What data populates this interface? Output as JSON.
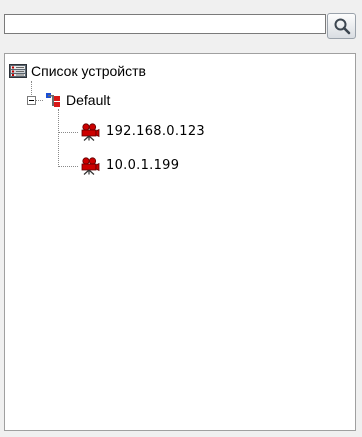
{
  "search": {
    "value": "",
    "placeholder": ""
  },
  "tree": {
    "root": {
      "label": "Список устройств",
      "icon": "device-list-icon"
    },
    "group": {
      "label": "Default",
      "icon": "network-group-icon",
      "expanded": true
    },
    "devices": [
      {
        "label": "192.168.0.123",
        "icon": "camera-icon"
      },
      {
        "label": "10.0.1.199",
        "icon": "camera-icon"
      }
    ]
  },
  "colors": {
    "camera": "#cc0000",
    "group_blue": "#1a4fd6",
    "group_red": "#d81818"
  }
}
